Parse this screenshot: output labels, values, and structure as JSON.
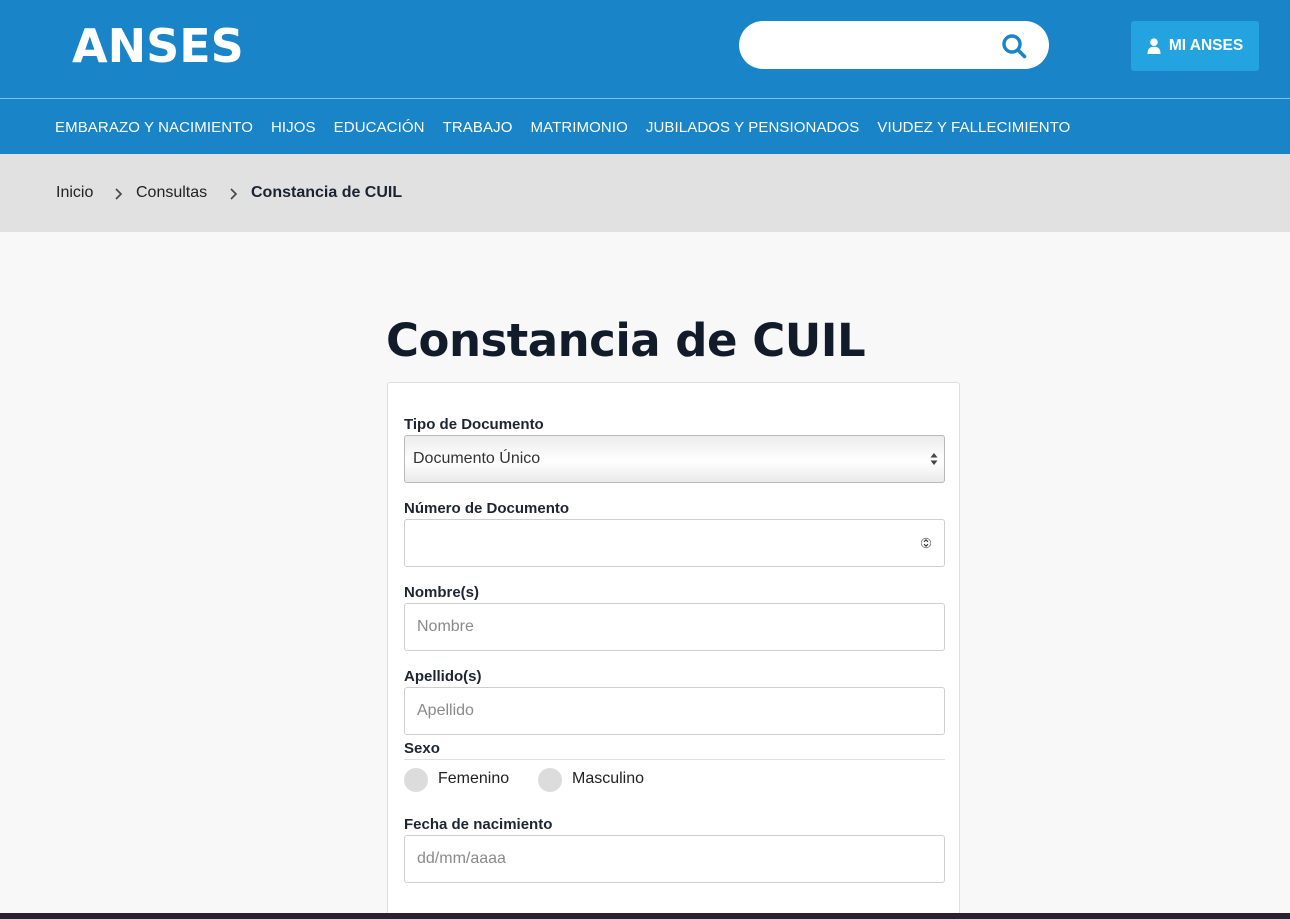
{
  "header": {
    "logo": "ANSES",
    "search": {
      "placeholder": "",
      "icon": "search-icon"
    },
    "account_button": {
      "label": "MI ANSES",
      "icon": "user-icon"
    },
    "colors": {
      "brand": "#1984c8",
      "accent": "#23a4e0"
    }
  },
  "nav": {
    "items": [
      "EMBARAZO Y NACIMIENTO",
      "HIJOS",
      "EDUCACIÓN",
      "TRABAJO",
      "MATRIMONIO",
      "JUBILADOS Y PENSIONADOS",
      "VIUDEZ Y FALLECIMIENTO"
    ]
  },
  "breadcrumb": {
    "items": [
      "Inicio",
      "Consultas",
      "Constancia de CUIL"
    ]
  },
  "page": {
    "title": "Constancia de CUIL"
  },
  "form": {
    "tipo_documento": {
      "label": "Tipo de Documento",
      "value": "Documento Único"
    },
    "numero_documento": {
      "label": "Número de Documento",
      "value": ""
    },
    "nombres": {
      "label": "Nombre(s)",
      "placeholder": "Nombre"
    },
    "apellidos": {
      "label": "Apellido(s)",
      "placeholder": "Apellido"
    },
    "sexo": {
      "label": "Sexo",
      "options": [
        "Femenino",
        "Masculino"
      ]
    },
    "fecha_nacimiento": {
      "label": "Fecha de nacimiento",
      "placeholder": "dd/mm/aaaa"
    }
  }
}
